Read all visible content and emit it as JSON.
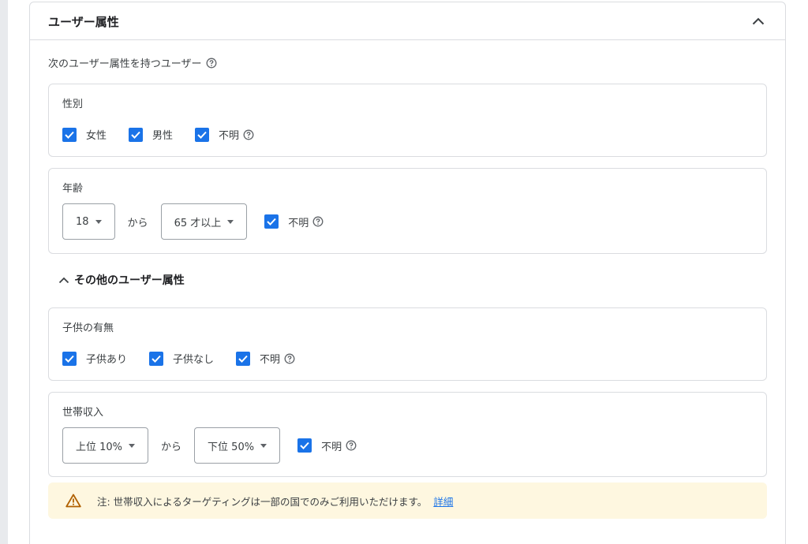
{
  "panel": {
    "title": "ユーザー属性",
    "intro": "次のユーザー属性を持つユーザー"
  },
  "gender": {
    "label": "性別",
    "options": [
      {
        "label": "女性",
        "checked": true
      },
      {
        "label": "男性",
        "checked": true
      },
      {
        "label": "不明",
        "checked": true
      }
    ]
  },
  "age": {
    "label": "年齢",
    "from": "18",
    "separator": "から",
    "to": "65 才以上",
    "unknown_label": "不明",
    "unknown_checked": true
  },
  "more_section": {
    "label": "その他のユーザー属性"
  },
  "parental": {
    "label": "子供の有無",
    "options": [
      {
        "label": "子供あり",
        "checked": true
      },
      {
        "label": "子供なし",
        "checked": true
      },
      {
        "label": "不明",
        "checked": true
      }
    ]
  },
  "income": {
    "label": "世帯収入",
    "from": "上位 10%",
    "separator": "から",
    "to": "下位 50%",
    "unknown_label": "不明",
    "unknown_checked": true
  },
  "warning": {
    "text": "注: 世帯収入によるターゲティングは一部の国でのみご利用いただけます。",
    "link": "詳細"
  },
  "colors": {
    "accent": "#1a73e8",
    "warning_bg": "#fef7e0",
    "warning_icon": "#b06000"
  }
}
